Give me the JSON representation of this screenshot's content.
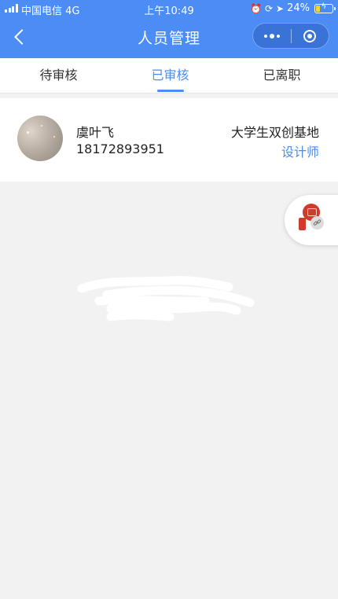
{
  "status_bar": {
    "carrier": "中国电信",
    "network": "4G",
    "time": "上午10:49",
    "battery": "24%",
    "battery_level": 0.24,
    "icons": [
      "signal-icon",
      "alarm-icon",
      "screen-lock-icon",
      "location-icon",
      "battery-icon"
    ]
  },
  "nav": {
    "title": "人员管理",
    "back_icon": "chevron-left-icon",
    "more_icon": "more-dots-icon",
    "close_icon": "target-close-icon"
  },
  "tabs": [
    {
      "label": "待审核",
      "active": false
    },
    {
      "label": "已审核",
      "active": true
    },
    {
      "label": "已离职",
      "active": false
    }
  ],
  "people": [
    {
      "name": "虞叶飞",
      "phone": "18172893951",
      "organization": "大学生双创基地",
      "role": "设计师"
    }
  ],
  "floating_button": {
    "icons": [
      "seal-icon",
      "link-icon"
    ]
  },
  "colors": {
    "primary": "#4b8cf5",
    "background": "#f2f2f2",
    "card": "#ffffff",
    "text": "#222222",
    "seal_red": "#d23a2c",
    "battery_fill": "#f5d33b"
  }
}
